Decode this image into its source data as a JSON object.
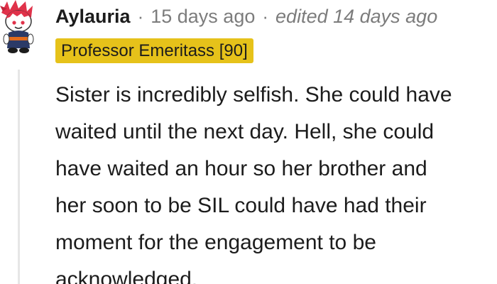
{
  "comment": {
    "author": "Aylauria",
    "separator": "·",
    "timestamp": "15 days ago",
    "edited": "edited 14 days ago",
    "flair": "Professor Emeritass [90]",
    "body_lines": [
      "Sister is incredibly selfish. She could have",
      "waited until the next day. Hell, she could",
      "have waited an hour so her brother and",
      "her soon to be SIL could have had their",
      "moment for the engagement to be",
      "acknowledged."
    ]
  },
  "colors": {
    "flair_background": "#e6c21a",
    "meta_text": "#7c7c7c",
    "body_text": "#1c1c1c",
    "thread_line": "#e6e6e6"
  },
  "icons": {
    "avatar": "snoo-avatar-icon"
  }
}
